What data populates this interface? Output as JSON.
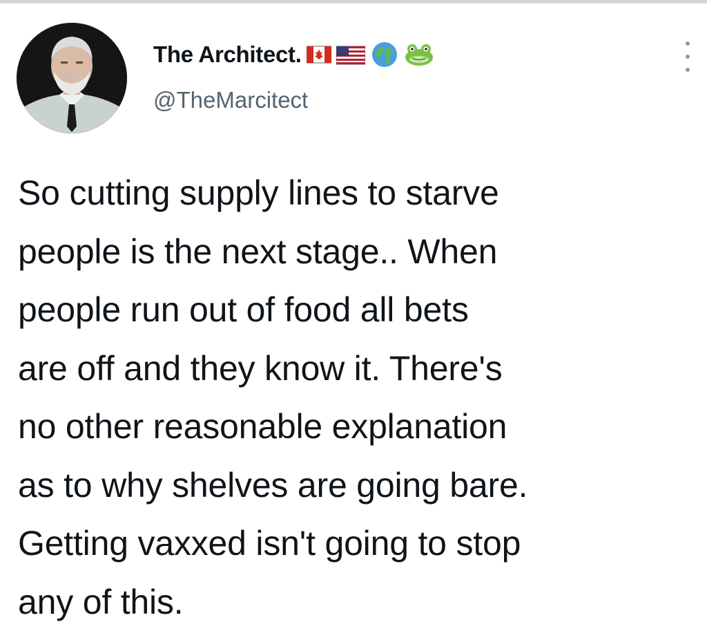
{
  "tweet": {
    "author": {
      "display_name": "The Architect.",
      "handle": "@TheMarcitect",
      "name_emojis": [
        "canada-flag-icon",
        "us-flag-icon",
        "globe-icon",
        "frog-icon"
      ],
      "avatar_icon": "profile-photo"
    },
    "menu_icon": "more-options-icon",
    "text_lines": [
      "So cutting supply lines to starve",
      "people is the next stage.. When",
      "people run out of food all bets",
      "are off and they know it. There's",
      "no other reasonable explanation",
      "as to why shelves are going bare.",
      "Getting vaxxed isn't going to stop",
      "any of this."
    ]
  },
  "colors": {
    "text_primary": "#0f1419",
    "text_secondary": "#536471",
    "background": "#ffffff"
  }
}
